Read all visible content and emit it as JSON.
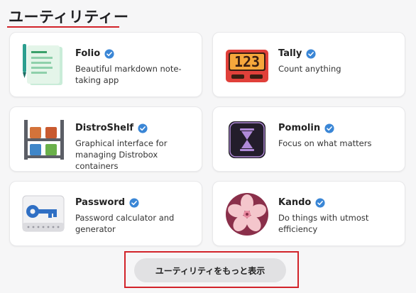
{
  "section": {
    "title": "ユーティリティー"
  },
  "apps": [
    {
      "name": "Folio",
      "description": "Beautiful markdown note-taking app",
      "icon": "notebook-icon",
      "verified": true
    },
    {
      "name": "Tally",
      "description": "Count anything",
      "icon": "counter-icon",
      "verified": true,
      "icon_text": "123"
    },
    {
      "name": "DistroShelf",
      "description": "Graphical interface for managing Distrobox containers",
      "icon": "shelf-icon",
      "verified": true
    },
    {
      "name": "Pomolin",
      "description": "Focus on what matters",
      "icon": "hourglass-icon",
      "verified": true
    },
    {
      "name": "Password",
      "description": "Password calculator and generator",
      "icon": "key-icon",
      "verified": true
    },
    {
      "name": "Kando",
      "description": "Do things with utmost efficiency",
      "icon": "flower-icon",
      "verified": true
    }
  ],
  "more_button": {
    "label": "ユーティリティをもっと表示"
  },
  "colors": {
    "accent_red": "#d2232a",
    "verified_blue": "#3a86d6"
  }
}
